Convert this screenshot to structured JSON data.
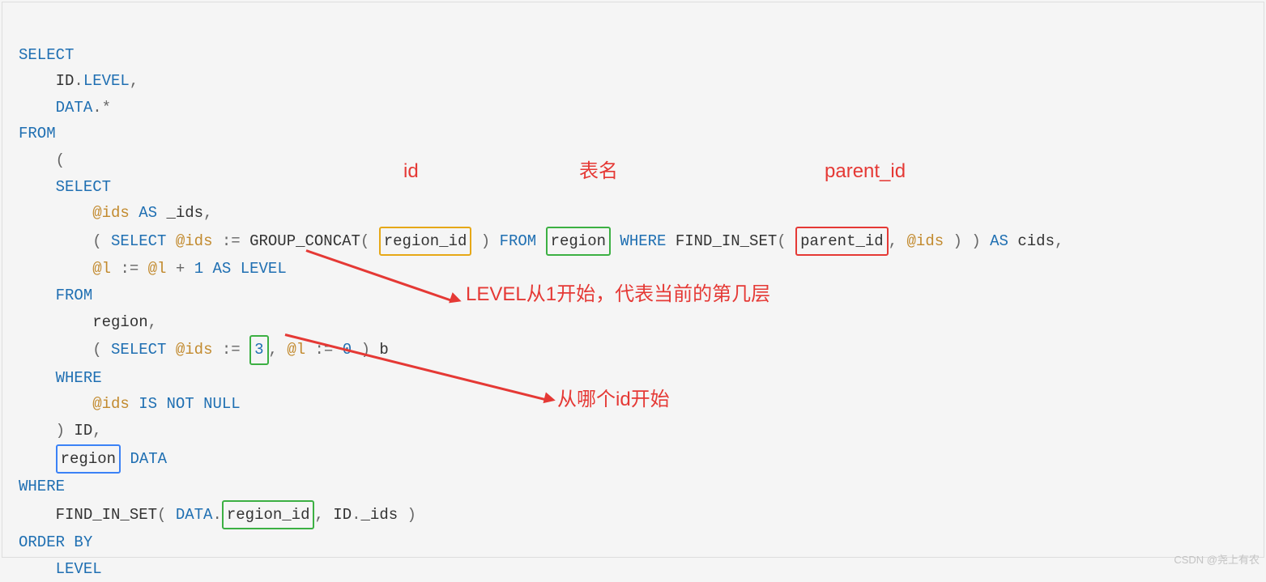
{
  "sql": {
    "l1": "SELECT",
    "l2_id": "ID",
    "l2_level": "LEVEL",
    "l3_data": "DATA",
    "l4": "FROM",
    "l6": "SELECT",
    "l7_var": "@ids",
    "l7_as": "AS",
    "l7_alias": "_ids",
    "l8_select": "SELECT",
    "l8_var": "@ids",
    "l8_assign": ":=",
    "l8_fn": "GROUP_CONCAT",
    "l8_arg": "region_id",
    "l8_from": "FROM",
    "l8_table": "region",
    "l8_where": "WHERE",
    "l8_fn2": "FIND_IN_SET",
    "l8_arg2": "parent_id",
    "l8_var2": "@ids",
    "l8_as": "AS",
    "l8_alias": "cids",
    "l9_v1": "@l",
    "l9_assign": ":=",
    "l9_v2": "@l",
    "l9_plus": "+",
    "l9_one": "1",
    "l9_as": "AS",
    "l9_level": "LEVEL",
    "l10": "FROM",
    "l11_t": "region",
    "l12_select": "SELECT",
    "l12_v1": "@ids",
    "l12_assign": ":=",
    "l12_val": "3",
    "l12_v2": "@l",
    "l12_assign2": ":=",
    "l12_zero": "0",
    "l12_b": "b",
    "l13": "WHERE",
    "l14_v": "@ids",
    "l14_is": "IS",
    "l14_not": "NOT",
    "l14_null": "NULL",
    "l15_id": "ID",
    "l16_t": "region",
    "l16_d": "DATA",
    "l17": "WHERE",
    "l18_fn": "FIND_IN_SET",
    "l18_d": "DATA",
    "l18_c": "region_id",
    "l18_id": "ID",
    "l18_f": "_ids",
    "l19_ob": "ORDER BY",
    "l20": "LEVEL"
  },
  "labels": {
    "id": "id",
    "table": "表名",
    "parent": "parent_id",
    "level": "LEVEL从1开始，代表当前的第几层",
    "start": "从哪个id开始"
  },
  "watermark": "CSDN @尧上有农"
}
